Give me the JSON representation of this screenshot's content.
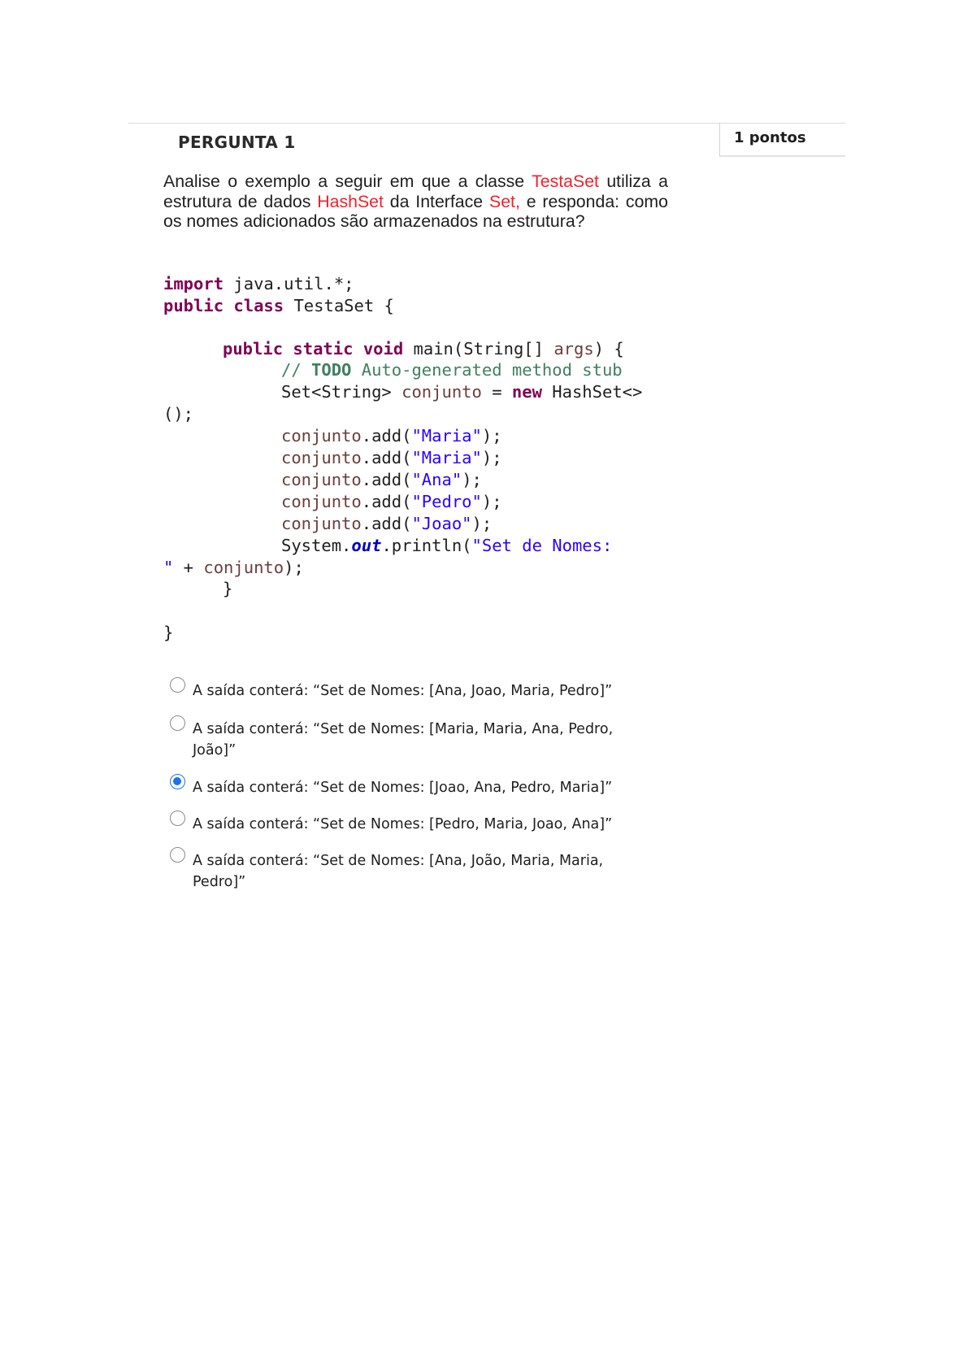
{
  "question": {
    "title": "PERGUNTA 1",
    "points": "1 pontos",
    "prompt": {
      "p1": "Analise o exemplo a seguir em que a classe ",
      "class_name": "TestaSet",
      "p2": " utiliza a estrutura de dados ",
      "structure": "HashSet",
      "p3": " da Interface ",
      "interface": "Set,",
      "p4": " e responda: como os nomes adicionados são armazenados na estrutura?"
    },
    "code": {
      "l1_kw": "import",
      "l1_rest": " java.util.*;",
      "l2_kw1": "public",
      "l2_kw2": "class",
      "l2_rest": " TestaSet {",
      "l3_kw1": "public",
      "l3_kw2": "static",
      "l3_kw3": "void",
      "l3_mid": " main(String[] ",
      "l3_var": "args",
      "l3_end": ") {",
      "l4_c1": "// ",
      "l4_todo": "TODO",
      "l4_c2": " Auto-generated method stub",
      "l5_a": "Set<String> ",
      "l5_var": "conjunto",
      "l5_b": " = ",
      "l5_kw": "new",
      "l5_c": " HashSet<>",
      "l6": "();",
      "add_var": "conjunto",
      "add_call": ".add(",
      "add_end": ");",
      "names": [
        "\"Maria\"",
        "\"Maria\"",
        "\"Ana\"",
        "\"Pedro\"",
        "\"Joao\""
      ],
      "l12_a": "System.",
      "l12_field": "out",
      "l12_b": ".println(",
      "l12_str": "\"Set de Nomes:",
      "l13_str": "\"",
      "l13_a": " + ",
      "l13_var": "conjunto",
      "l13_b": ");",
      "brace": "}"
    },
    "options": [
      {
        "label": "A saída conterá: “Set de Nomes: [Ana, Joao, Maria, Pedro]”",
        "selected": false
      },
      {
        "label": "A saída conterá: “Set de Nomes: [Maria, Maria, Ana, Pedro, João]”",
        "selected": false
      },
      {
        "label": "A saída conterá: “Set de Nomes: [Joao, Ana, Pedro, Maria]”",
        "selected": true
      },
      {
        "label": "A saída conterá: “Set de Nomes: [Pedro, Maria, Joao, Ana]”",
        "selected": false
      },
      {
        "label": "A saída conterá: “Set de Nomes: [Ana, João, Maria, Maria, Pedro]”",
        "selected": false
      }
    ]
  }
}
